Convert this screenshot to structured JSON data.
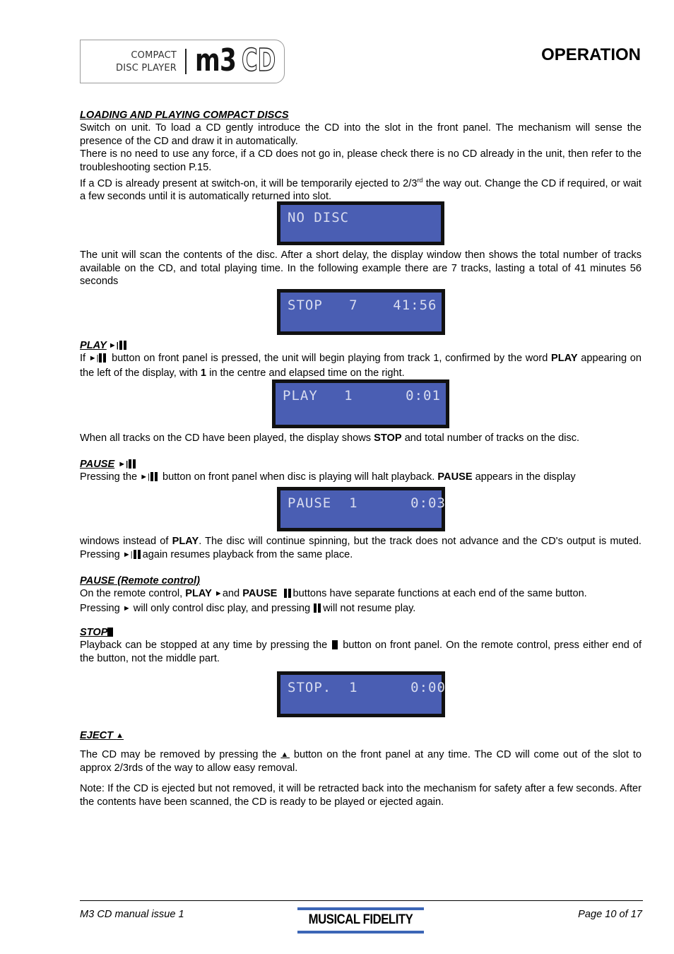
{
  "header": {
    "logo": {
      "line1": "COMPACT",
      "line2": "DISC PLAYER",
      "model": "m3",
      "suffix": "CD"
    },
    "title": "OPERATION"
  },
  "sections": {
    "loading": {
      "heading": "LOADING  AND  PLAYING  COMPACT DISCS",
      "p1": " Switch on unit. To load a CD gently introduce the CD into the slot in the front panel. The mechanism will sense the presence of the CD and draw it in automatically.",
      "p2": "There is no need to use any force, if a CD does not go in, please check there is no CD already in the unit, then refer to the troubleshooting section P.15.",
      "p3a": " If a CD is already present at switch-on, it will be temporarily ejected to 2/3",
      "p3sup": "rd",
      "p3b": " the way out. Change the CD if required, or wait a few seconds until it is automatically returned into slot.",
      "display1": "NO DISC",
      "p4": "The unit will scan the contents of the disc.  After a short delay, the display window then shows the total number of tracks available on the CD, and total playing time. In the following example there are 7 tracks, lasting a total of 41 minutes 56 seconds",
      "display2": "STOP   7    41:56"
    },
    "play": {
      "heading": "PLAY",
      "p1a": "If ",
      "p1b": " button on front panel is pressed, the unit will begin playing from track 1, confirmed by the word ",
      "p1bold1": "PLAY",
      "p1c": " appearing on the left of the display, with ",
      "p1bold2": "1",
      "p1d": " in the centre and elapsed time on the right.",
      "display": "PLAY   1      0:01",
      "p2a": "When all tracks on the CD have been played, the display shows ",
      "p2bold": "STOP",
      "p2b": " and total number of tracks on the disc."
    },
    "pause": {
      "heading": "PAUSE",
      "p1a": "Pressing the ",
      "p1b": " button on front panel when disc is playing will halt playback.  ",
      "p1bold": "PAUSE",
      "p1c": " appears in the display",
      "display": "PAUSE  1      0:03",
      "p2a": "windows instead of ",
      "p2bold": "PLAY",
      "p2b": ".  The disc will continue spinning, but the track does not advance and the CD's output is muted. Pressing ",
      "p2c": "again resumes playback from the same place."
    },
    "pause_remote": {
      "heading": "PAUSE  (Remote control)",
      "p1a": "On the remote control, ",
      "p1bold1": "PLAY",
      "p1b": "and ",
      "p1bold2": "PAUSE",
      "p1c": "buttons have separate functions at each end of the same button.",
      "p2a": "Pressing ",
      "p2b": " will only control disc play, and pressing ",
      "p2c": "will not resume play."
    },
    "stop": {
      "heading": "STOP",
      "p1a": "Playback can be stopped at any time by pressing the ",
      "p1b": " button on front panel.  On the remote control, press either end of the button, not the middle part.",
      "display": "STOP.  1      0:00"
    },
    "eject": {
      "heading": "EJECT",
      "p1a": " The CD may be removed by pressing the ",
      "p1b": " button on the front panel at any time. The CD will come out of the slot to approx 2/3rds of the way to allow easy removal.",
      "p2": "Note:  If the CD is ejected but not removed, it will be retracted back into the mechanism for safety after a few seconds. After the contents have been scanned, the CD is ready to be played or ejected again."
    }
  },
  "symbols": {
    "play_skip": "►|",
    "play": "►",
    "eject": "▲"
  },
  "footer": {
    "left": "M3 CD manual issue 1",
    "brand": "MUSICAL FIDELITY",
    "right": "Page 10 of 17"
  },
  "colors": {
    "lcd_background": "#4a5eb3",
    "lcd_text": "#d8dcf0",
    "brand_blue": "#3c66b6"
  }
}
